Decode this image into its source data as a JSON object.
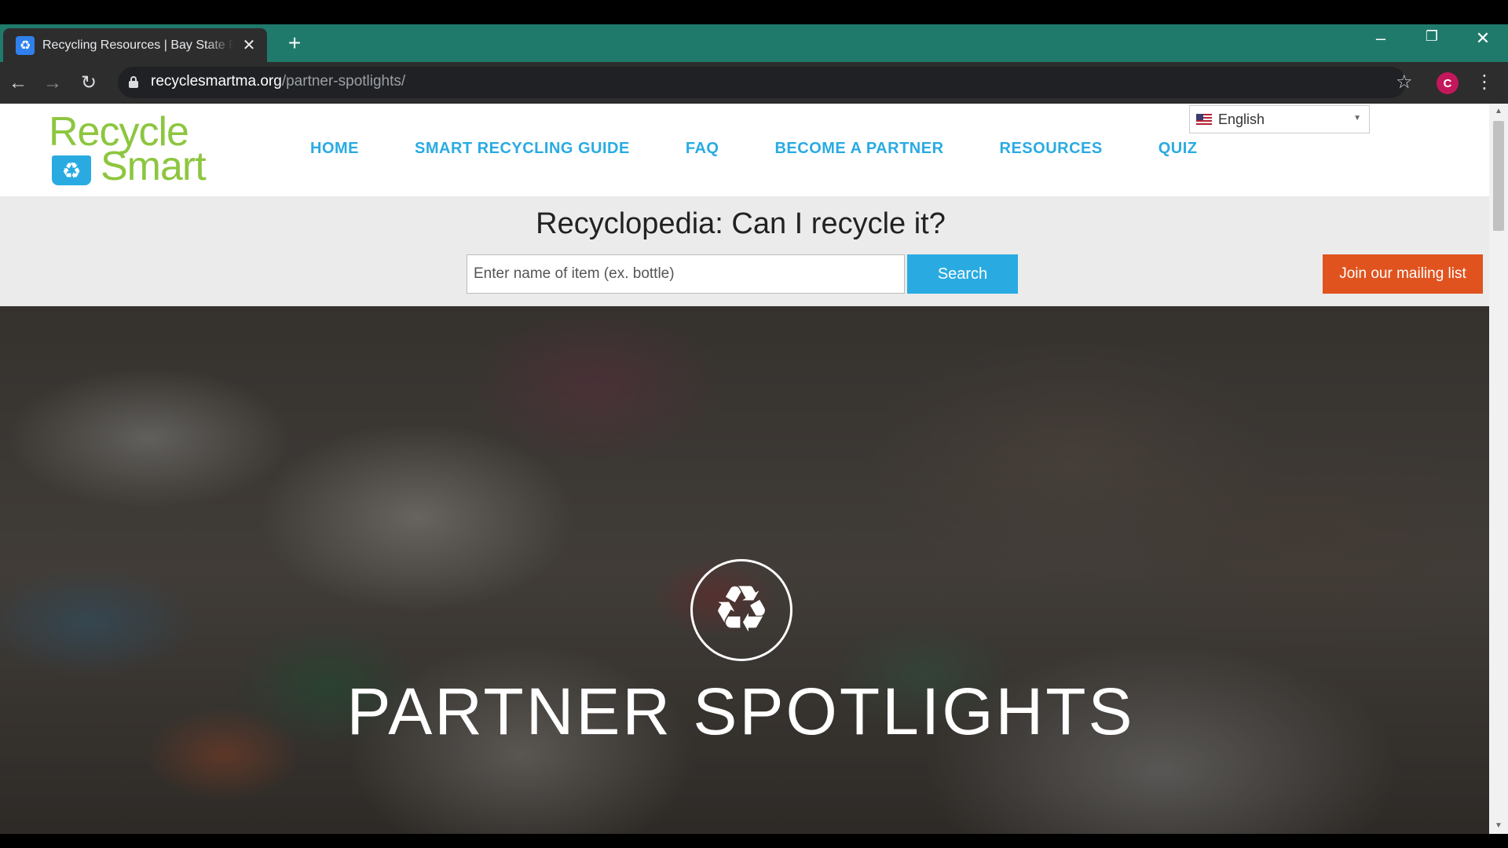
{
  "browser": {
    "tab_title": "Recycling Resources | Bay State R",
    "url_domain": "recyclesmartma.org",
    "url_path": "/partner-spotlights/",
    "profile_initial": "C"
  },
  "site": {
    "logo_line1": "Recycle",
    "logo_line2": "Smart",
    "nav": [
      "HOME",
      "SMART RECYCLING GUIDE",
      "FAQ",
      "BECOME A PARTNER",
      "RESOURCES",
      "QUIZ"
    ],
    "language": "English",
    "recyclopedia_heading": "Recyclopedia: Can I recycle it?",
    "search_placeholder": "Enter name of item (ex. bottle)",
    "search_label": "Search",
    "mailing_label": "Join our mailing list",
    "hero_title": "PARTNER SPOTLIGHTS"
  },
  "colors": {
    "tabstrip": "#1f7a6c",
    "brand_green": "#8dc63f",
    "brand_blue": "#29abe2",
    "mailing_orange": "#e0531f"
  },
  "icons": [
    "favicon-icon",
    "close-icon",
    "plus-icon",
    "minimize-icon",
    "restore-icon",
    "window-close-icon",
    "back-icon",
    "forward-icon",
    "reload-icon",
    "lock-icon",
    "star-icon",
    "more-icon",
    "flag-us-icon",
    "caret-down-icon",
    "recycle-icon"
  ]
}
